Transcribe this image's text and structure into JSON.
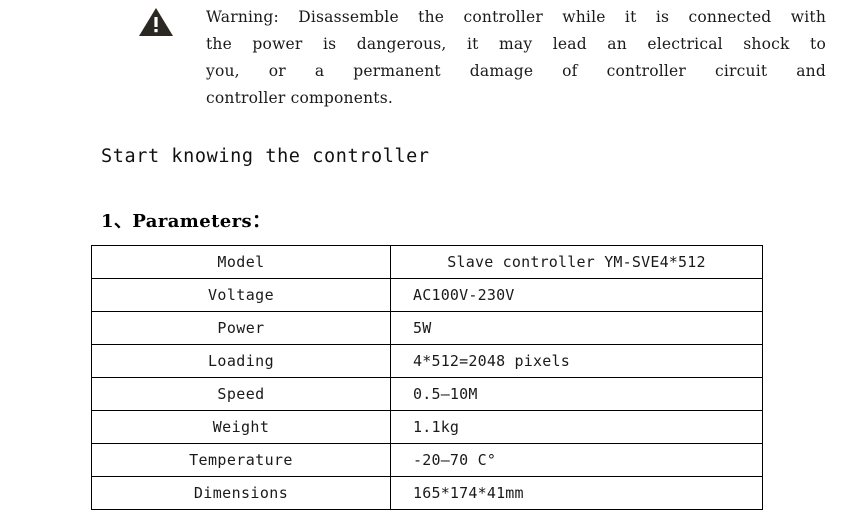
{
  "warning": {
    "icon": "warning-triangle-icon",
    "lines": [
      "Warning: Disassemble the controller while it is connected with",
      "the power is dangerous, it may  lead an electrical shock to",
      "you, or a permanent damage of controller circuit and",
      "controller components."
    ],
    "full_text": "Warning: Disassemble the controller while it is connected with the power is dangerous, it may  lead an electrical shock to you, or a permanent damage of controller circuit and controller components."
  },
  "section": {
    "title": "Start knowing the controller"
  },
  "parameters": {
    "heading_number": "1、",
    "heading_label": "Parameters：",
    "heading_full": "1、Parameters：",
    "rows": [
      {
        "label": "Model",
        "value": "Slave controller YM-SVE4*512"
      },
      {
        "label": "Voltage",
        "value": "AC100V-230V"
      },
      {
        "label": "Power",
        "value": "5W"
      },
      {
        "label": "Loading",
        "value": "4*512=2048 pixels"
      },
      {
        "label": "Speed",
        "value": "0.5—10M"
      },
      {
        "label": "Weight",
        "value": "1.1kg"
      },
      {
        "label": "Temperature",
        "value": "-20—70 C°"
      },
      {
        "label": "Dimensions",
        "value": "165*174*41mm"
      }
    ]
  },
  "colors": {
    "text": "#1a1a1a",
    "border": "#000000",
    "background": "#ffffff",
    "icon_fill": "#2b2722"
  }
}
